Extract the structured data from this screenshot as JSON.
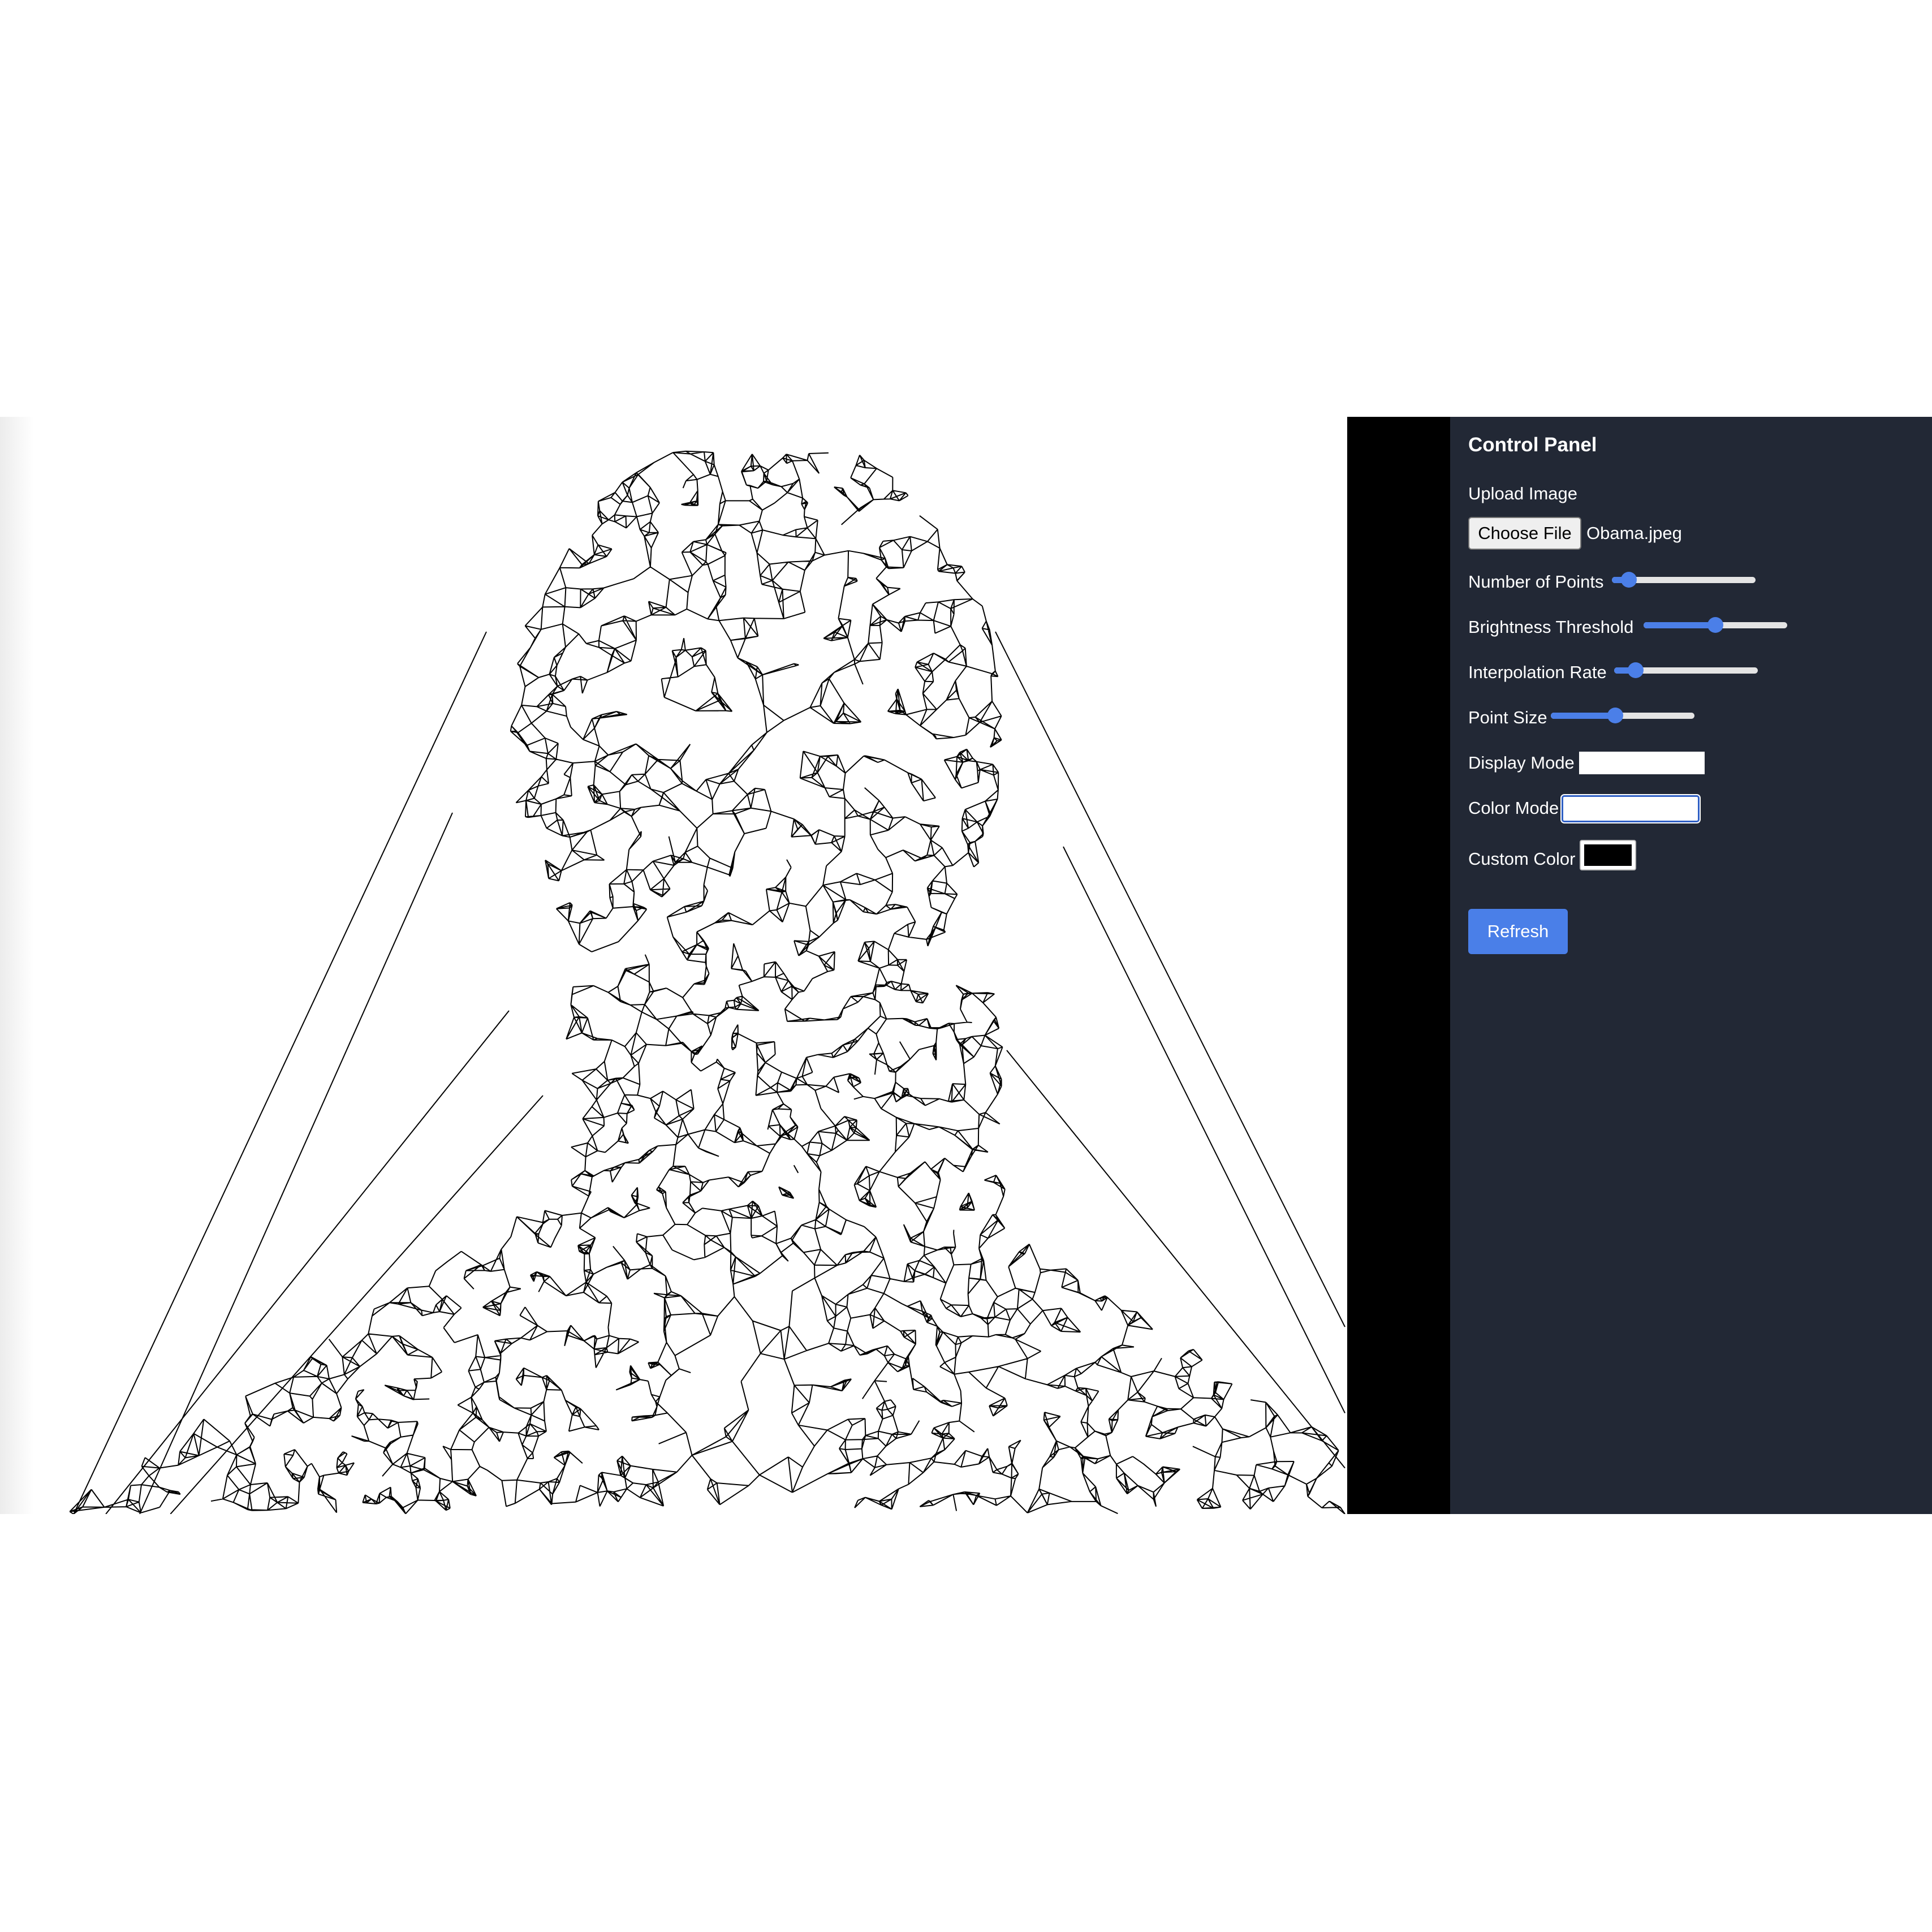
{
  "control_panel": {
    "title": "Control Panel",
    "upload_label": "Upload Image",
    "choose_file_label": "Choose File",
    "file_name": "Obama.jpeg",
    "sliders": [
      {
        "label": "Number of Points",
        "value": 0.12
      },
      {
        "label": "Brightness Threshold",
        "value": 0.5
      },
      {
        "label": "Interpolation Rate",
        "value": 0.15
      },
      {
        "label": "Point Size",
        "value": 0.45
      }
    ],
    "display_mode_label": "Display Mode",
    "display_mode_value": "",
    "color_mode_label": "Color Mode",
    "color_mode_value": "",
    "custom_color_label": "Custom Color",
    "custom_color_value": "#000000",
    "refresh_label": "Refresh"
  },
  "colors": {
    "panel_background": "#222835",
    "gutter": "#000000",
    "accent": "#4a7fe8",
    "mesh_stroke": "#000000"
  }
}
